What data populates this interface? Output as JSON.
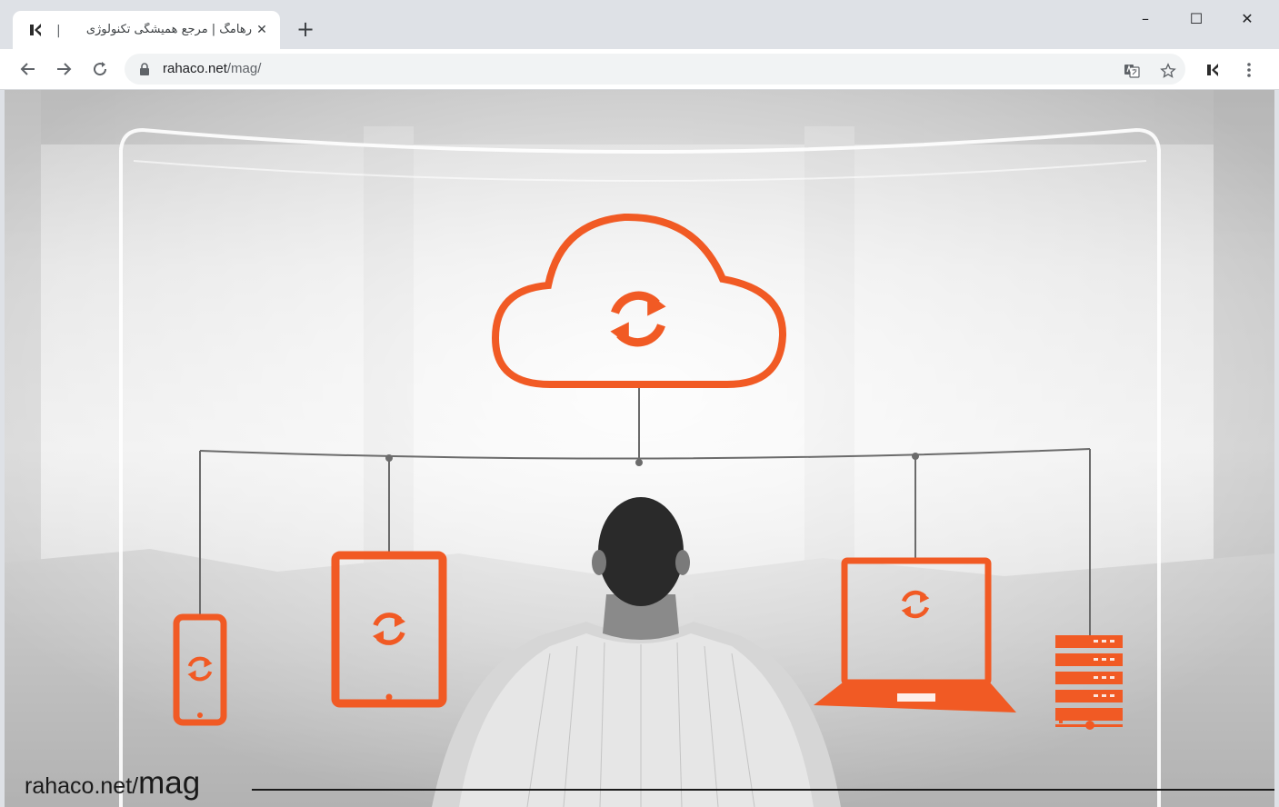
{
  "browser": {
    "tab": {
      "separator": "|",
      "title": "رهامگ | مرجع همیشگی تکنولوژی",
      "close_label": "✕",
      "favicon": "rahamag-logo-icon"
    },
    "new_tab_label": "+",
    "window_controls": {
      "minimize": "–",
      "maximize": "☐",
      "close": "✕"
    },
    "address": {
      "host": "rahaco.net",
      "path": "/mag/"
    },
    "icons": [
      "back-icon",
      "forward-icon",
      "reload-icon",
      "lock-icon",
      "translate-icon",
      "star-icon",
      "extension-icon",
      "menu-icon"
    ]
  },
  "page": {
    "illustration": "cloud-sync-icons",
    "watermark": {
      "prefix": "rahaco.net/",
      "suffix": "mag"
    },
    "accent_color": "#f15a24"
  }
}
